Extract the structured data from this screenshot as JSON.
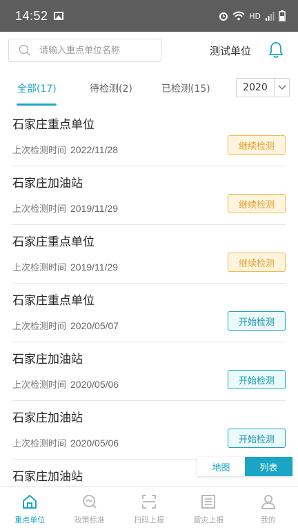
{
  "status_bar": {
    "time": "14:52",
    "network": "HD"
  },
  "header": {
    "search_placeholder": "请输入重点单位名称",
    "unit_label": "测试单位"
  },
  "tabs": [
    {
      "label": "全部(17)",
      "active": true
    },
    {
      "label": "待检测(2)",
      "active": false
    },
    {
      "label": "已检测(15)",
      "active": false
    }
  ],
  "year_select": {
    "value": "2020"
  },
  "list": {
    "meta_label": "上次检测时间",
    "items": [
      {
        "name": "石家庄重点单位",
        "date": "2022/11/28",
        "action": "继续检测"
      },
      {
        "name": "石家庄加油站",
        "date": "2019/11/29",
        "action": "继续检测"
      },
      {
        "name": "石家庄重点单位",
        "date": "2019/11/29",
        "action": "继续检测"
      },
      {
        "name": "石家庄重点单位",
        "date": "2020/05/07",
        "action": "开始检测"
      },
      {
        "name": "石家庄加油站",
        "date": "2020/05/06",
        "action": "开始检测"
      },
      {
        "name": "石家庄加油站",
        "date": "2020/05/06",
        "action": "开始检测"
      },
      {
        "name": "石家庄加油站"
      }
    ]
  },
  "view_toggle": {
    "map_label": "地图",
    "list_label": "列表",
    "selected": "列表"
  },
  "bottom_nav": [
    {
      "label": "重点单位",
      "icon": "home-icon",
      "active": true
    },
    {
      "label": "政策标准",
      "icon": "policy-search-icon",
      "active": false
    },
    {
      "label": "扫码上报",
      "icon": "scan-icon",
      "active": false
    },
    {
      "label": "雷灾上报",
      "icon": "document-icon",
      "active": false
    },
    {
      "label": "我的",
      "icon": "user-icon",
      "active": false
    }
  ],
  "colors": {
    "accent": "#1aa5c4",
    "continue": "#f5b744",
    "status_bar": "#5d5d5d"
  }
}
